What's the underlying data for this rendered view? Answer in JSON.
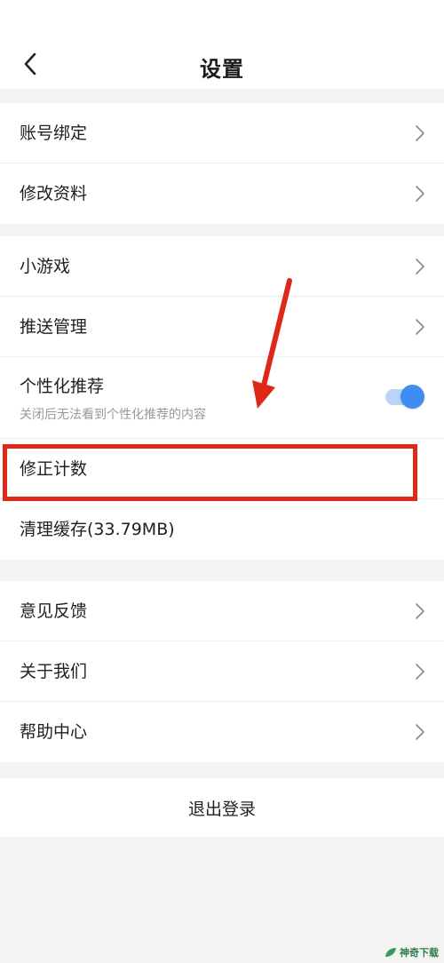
{
  "header": {
    "title": "设置",
    "back_icon": "chevron-left-icon"
  },
  "groups": [
    {
      "items": [
        {
          "label": "账号绑定",
          "chevron": true
        },
        {
          "label": "修改资料",
          "chevron": true
        }
      ]
    },
    {
      "items": [
        {
          "label": "小游戏",
          "chevron": true
        },
        {
          "label": "推送管理",
          "chevron": true
        },
        {
          "label": "个性化推荐",
          "sublabel": "关闭后无法看到个性化推荐的内容",
          "toggle": true,
          "toggle_on": true
        },
        {
          "label": "修正计数",
          "chevron": false
        },
        {
          "label": "清理缓存(33.79MB)",
          "chevron": false
        }
      ]
    },
    {
      "items": [
        {
          "label": "意见反馈",
          "chevron": true
        },
        {
          "label": "关于我们",
          "chevron": true
        },
        {
          "label": "帮助中心",
          "chevron": true
        }
      ]
    }
  ],
  "logout": {
    "label": "退出登录"
  },
  "annotation": {
    "highlight_color": "#e0281a",
    "highlighted_item": "修正计数"
  },
  "colors": {
    "accent": "#3f8cf2",
    "toggle_track": "#b8d4f8",
    "background": "#f3f3f3"
  },
  "watermark": {
    "text": "神奇下载"
  }
}
